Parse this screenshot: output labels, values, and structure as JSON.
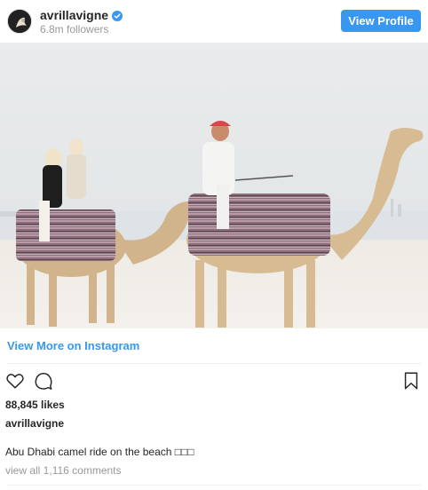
{
  "header": {
    "username": "avrillavigne",
    "followers": "6.8m followers",
    "view_profile_label": "View Profile"
  },
  "post": {
    "view_more_label": "View More on Instagram",
    "likes": "88,845 likes",
    "owner": "avrillavigne",
    "caption": "Abu Dhabi camel ride on the beach □□□",
    "comments_link": "view all 1,116 comments"
  },
  "colors": {
    "accent": "#3897f0",
    "muted": "#999999",
    "text": "#262626"
  },
  "icons": {
    "like": "heart-icon",
    "comment": "comment-icon",
    "save": "bookmark-icon",
    "verified": "verified-badge-icon"
  }
}
